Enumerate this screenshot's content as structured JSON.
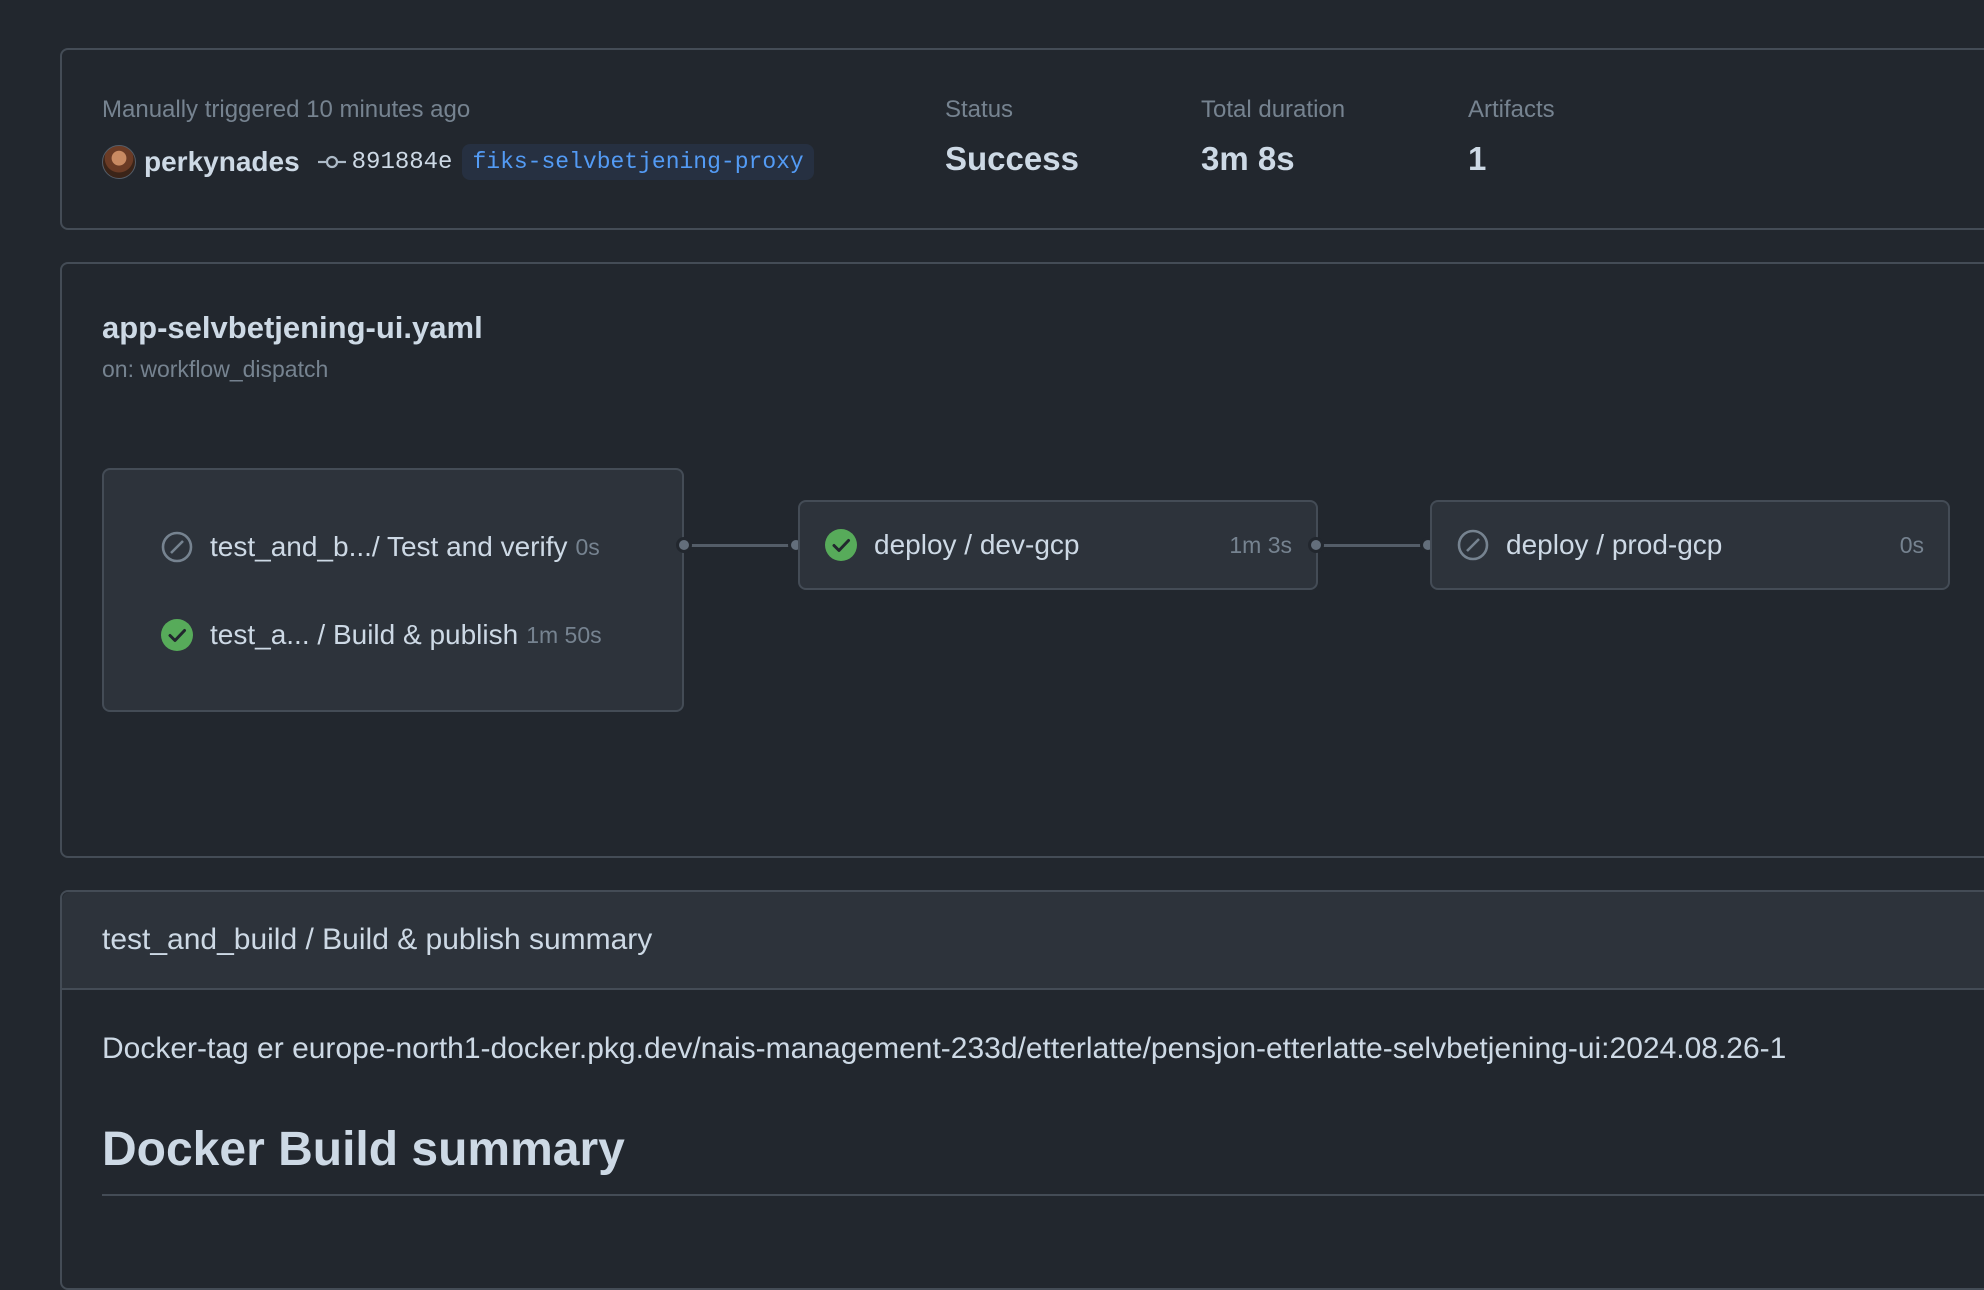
{
  "summary": {
    "trigger_text": "Manually triggered 10 minutes ago",
    "actor": "perkynades",
    "commit_sha": "891884e",
    "branch": "fiks-selvbetjening-proxy",
    "status_label": "Status",
    "status_value": "Success",
    "duration_label": "Total duration",
    "duration_value": "3m 8s",
    "artifacts_label": "Artifacts",
    "artifacts_value": "1"
  },
  "workflow": {
    "file": "app-selvbetjening-ui.yaml",
    "trigger": "on: workflow_dispatch",
    "group_jobs": [
      {
        "name": "test_and_b.../ Test and verify",
        "duration": "0s",
        "status": "skipped"
      },
      {
        "name": "test_a... / Build & publish",
        "duration": "1m 50s",
        "status": "success"
      }
    ],
    "jobs": [
      {
        "name": "deploy / dev-gcp",
        "duration": "1m 3s",
        "status": "success"
      },
      {
        "name": "deploy / prod-gcp",
        "duration": "0s",
        "status": "skipped"
      }
    ]
  },
  "job_summary": {
    "title": "test_and_build / Build & publish summary",
    "docker_tag_text": "Docker-tag er europe-north1-docker.pkg.dev/nais-management-233d/etterlatte/pensjon-etterlatte-selvbetjening-ui:2024.08.26-1",
    "heading": "Docker Build summary"
  },
  "colors": {
    "success": "#57ab5a",
    "skipped": "#768390",
    "link": "#539bf5"
  }
}
